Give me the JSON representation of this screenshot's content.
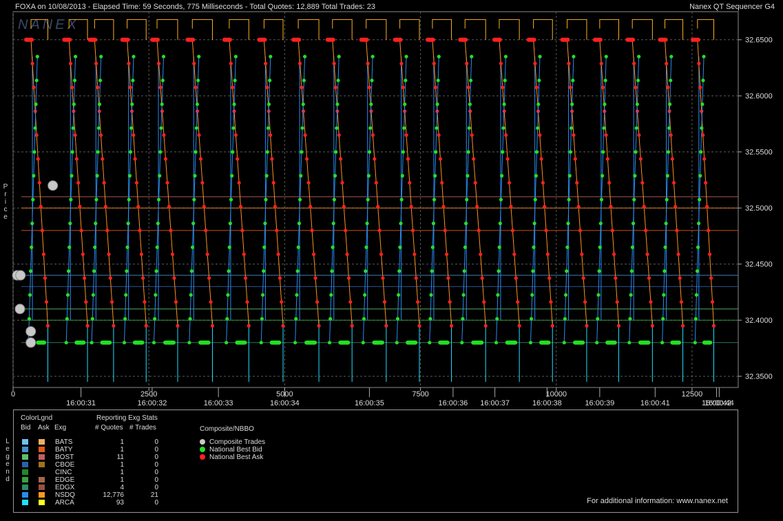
{
  "header": {
    "left": "FOXA on 10/08/2013  -  Elapsed Time: 59 Seconds, 775 Milliseconds  -  Total Quotes: 12,889  Total Trades: 23",
    "right": "Nanex QT Sequencer G4"
  },
  "watermark": "NANEX",
  "y_axis_title": "Price",
  "legend_vertical_title": "Legend",
  "chart_data": {
    "type": "line",
    "ylim": [
      32.34,
      32.675
    ],
    "y_ticks": [
      "32.3500",
      "32.4000",
      "32.4500",
      "32.5000",
      "32.5500",
      "32.6000",
      "32.6500"
    ],
    "y_tick_values": [
      32.35,
      32.4,
      32.45,
      32.5,
      32.55,
      32.6,
      32.65
    ],
    "xlim": [
      0,
      13350
    ],
    "x_seq_ticks": [
      "0",
      "2500",
      "5000",
      "7500",
      "10000",
      "12500"
    ],
    "x_seq_values": [
      0,
      2500,
      5000,
      7500,
      10000,
      12500
    ],
    "time_labels": [
      "16:00:31",
      "16:00:32",
      "16:00:33",
      "16:00:34",
      "16:00:35",
      "16:00:36",
      "16:00:37",
      "16:00:38",
      "16:00:39",
      "16:00:41",
      "16:00:42",
      "16:00:44"
    ],
    "time_positions": [
      1250,
      2560,
      3780,
      5000,
      6560,
      8100,
      8870,
      9830,
      10800,
      11820,
      12950,
      13000
    ],
    "grid": true,
    "cycles": [
      {
        "x": 330,
        "w": 310
      },
      {
        "x": 1030,
        "w": 340
      },
      {
        "x": 1500,
        "w": 350
      },
      {
        "x": 2100,
        "w": 350
      },
      {
        "x": 2650,
        "w": 380
      },
      {
        "x": 3300,
        "w": 370
      },
      {
        "x": 3980,
        "w": 360
      },
      {
        "x": 4620,
        "w": 350
      },
      {
        "x": 5250,
        "w": 380
      },
      {
        "x": 5880,
        "w": 360
      },
      {
        "x": 6500,
        "w": 370
      },
      {
        "x": 7120,
        "w": 360
      },
      {
        "x": 7720,
        "w": 350
      },
      {
        "x": 8320,
        "w": 380
      },
      {
        "x": 8950,
        "w": 370
      },
      {
        "x": 9580,
        "w": 350
      },
      {
        "x": 10200,
        "w": 360
      },
      {
        "x": 10800,
        "w": 350
      },
      {
        "x": 11400,
        "w": 370
      },
      {
        "x": 12000,
        "w": 330
      },
      {
        "x": 12600,
        "w": 300
      }
    ],
    "composite_trades": [
      {
        "x": 0,
        "y": 32.44
      },
      {
        "x": 60,
        "y": 32.44
      },
      {
        "x": 50,
        "y": 32.41
      },
      {
        "x": 250,
        "y": 32.39
      },
      {
        "x": 250,
        "y": 32.38
      },
      {
        "x": 655,
        "y": 32.52
      }
    ],
    "series": [
      {
        "name": "National Best Bid",
        "color": "#22e022"
      },
      {
        "name": "National Best Ask",
        "color": "#ff2020"
      },
      {
        "name": "Composite Trades",
        "color": "#cfcfcf"
      }
    ]
  },
  "legend": {
    "color_legend_title": "ColorLgnd",
    "reporting_title": "Reporting Exg Stats",
    "composite_title": "Composite/NBBO",
    "col_bid": "Bid",
    "col_ask": "Ask",
    "col_exg": "Exg",
    "col_quotes": "# Quotes",
    "col_trades": "# Trades",
    "rows": [
      {
        "exg": "BATS",
        "quotes": "1",
        "trades": "0",
        "bid_color": "#6ec3f0",
        "ask_color": "#f0b060"
      },
      {
        "exg": "BATY",
        "quotes": "1",
        "trades": "0",
        "bid_color": "#4a8ed0",
        "ask_color": "#e05a1a"
      },
      {
        "exg": "BOST",
        "quotes": "11",
        "trades": "0",
        "bid_color": "#5fbf6a",
        "ask_color": "#c06060"
      },
      {
        "exg": "CBOE",
        "quotes": "1",
        "trades": "0",
        "bid_color": "#2f5fa8",
        "ask_color": "#a07020"
      },
      {
        "exg": "CINC",
        "quotes": "1",
        "trades": "0",
        "bid_color": "#1e8a2a",
        "ask_color": "#000000"
      },
      {
        "exg": "EDGE",
        "quotes": "1",
        "trades": "0",
        "bid_color": "#3aa040",
        "ask_color": "#a06850"
      },
      {
        "exg": "EDGX",
        "quotes": "4",
        "trades": "0",
        "bid_color": "#2e8a60",
        "ask_color": "#9a5040"
      },
      {
        "exg": "NSDQ",
        "quotes": "12,776",
        "trades": "21",
        "bid_color": "#2a8cf0",
        "ask_color": "#ff9a20"
      },
      {
        "exg": "ARCA",
        "quotes": "93",
        "trades": "0",
        "bid_color": "#20e0ff",
        "ask_color": "#ffff20"
      }
    ],
    "nbbo": [
      {
        "label": "Composite Trades",
        "color": "#c8c8c8"
      },
      {
        "label": "National Best Bid",
        "color": "#22e022"
      },
      {
        "label": "National Best Ask",
        "color": "#ff2020"
      }
    ],
    "footer": "For additional information: www.nanex.net"
  }
}
